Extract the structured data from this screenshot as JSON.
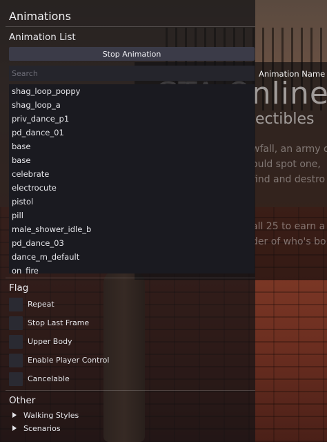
{
  "panel": {
    "title": "Animations",
    "animation_list_title": "Animation List",
    "stop_button_label": "Stop Animation",
    "search_placeholder": "Search",
    "animations": [
      "shag_loop_poppy",
      "shag_loop_a",
      "priv_dance_p1",
      "pd_dance_01",
      "base",
      "base",
      "celebrate",
      "electrocute",
      "pistol",
      "pill",
      "male_shower_idle_b",
      "pd_dance_03",
      "dance_m_default",
      "on_fire"
    ],
    "flag_title": "Flag",
    "flags": [
      {
        "label": "Repeat",
        "checked": false
      },
      {
        "label": "Stop Last Frame",
        "checked": false
      },
      {
        "label": "Upper Body",
        "checked": false
      },
      {
        "label": "Enable Player Control",
        "checked": false
      },
      {
        "label": "Cancelable",
        "checked": false
      }
    ],
    "other_title": "Other",
    "other_items": [
      "Walking Styles",
      "Scenarios"
    ]
  },
  "article": {
    "column_header": "Animation Name",
    "title": "GTA Online",
    "subtitle": "ectibles",
    "lines": [
      "wfall, an army of",
      "ould spot one,",
      "find and destro",
      "all 25 to earn a",
      "der of who's bo"
    ]
  }
}
